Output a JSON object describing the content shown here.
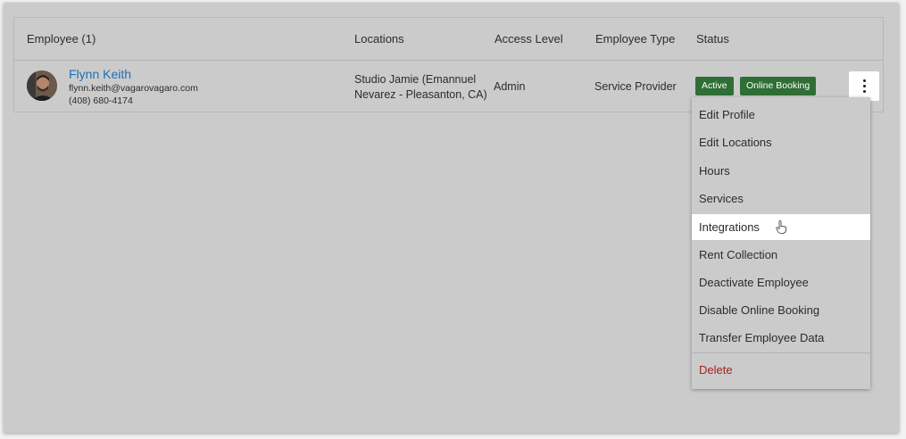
{
  "table": {
    "headers": {
      "employee": "Employee (1)",
      "locations": "Locations",
      "access_level": "Access Level",
      "employee_type": "Employee Type",
      "status": "Status"
    },
    "row": {
      "name": "Flynn Keith",
      "email": "flynn.keith@vagarovagaro.com",
      "phone": "(408) 680-4174",
      "location": "Studio Jamie (Emannuel Nevarez - Pleasanton, CA)",
      "access_level": "Admin",
      "employee_type": "Service Provider",
      "status_badges": [
        "Active",
        "Online Booking"
      ]
    }
  },
  "menu": {
    "items": [
      "Edit Profile",
      "Edit Locations",
      "Hours",
      "Services",
      "Integrations",
      "Rent Collection",
      "Deactivate Employee",
      "Disable Online Booking",
      "Transfer Employee Data"
    ],
    "hovered_item": "Integrations",
    "delete_label": "Delete"
  },
  "colors": {
    "link": "#1c6fb4",
    "badge": "#2f6e35",
    "danger": "#a3231f",
    "overlay": "#cbcbcb"
  }
}
